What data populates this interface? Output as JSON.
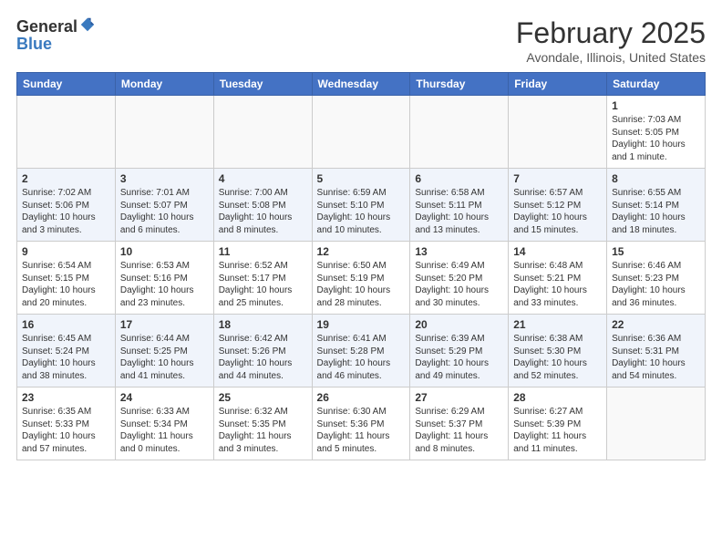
{
  "header": {
    "logo_general": "General",
    "logo_blue": "Blue",
    "month_title": "February 2025",
    "subtitle": "Avondale, Illinois, United States"
  },
  "weekdays": [
    "Sunday",
    "Monday",
    "Tuesday",
    "Wednesday",
    "Thursday",
    "Friday",
    "Saturday"
  ],
  "weeks": [
    [
      {
        "day": "",
        "info": ""
      },
      {
        "day": "",
        "info": ""
      },
      {
        "day": "",
        "info": ""
      },
      {
        "day": "",
        "info": ""
      },
      {
        "day": "",
        "info": ""
      },
      {
        "day": "",
        "info": ""
      },
      {
        "day": "1",
        "info": "Sunrise: 7:03 AM\nSunset: 5:05 PM\nDaylight: 10 hours\nand 1 minute."
      }
    ],
    [
      {
        "day": "2",
        "info": "Sunrise: 7:02 AM\nSunset: 5:06 PM\nDaylight: 10 hours\nand 3 minutes."
      },
      {
        "day": "3",
        "info": "Sunrise: 7:01 AM\nSunset: 5:07 PM\nDaylight: 10 hours\nand 6 minutes."
      },
      {
        "day": "4",
        "info": "Sunrise: 7:00 AM\nSunset: 5:08 PM\nDaylight: 10 hours\nand 8 minutes."
      },
      {
        "day": "5",
        "info": "Sunrise: 6:59 AM\nSunset: 5:10 PM\nDaylight: 10 hours\nand 10 minutes."
      },
      {
        "day": "6",
        "info": "Sunrise: 6:58 AM\nSunset: 5:11 PM\nDaylight: 10 hours\nand 13 minutes."
      },
      {
        "day": "7",
        "info": "Sunrise: 6:57 AM\nSunset: 5:12 PM\nDaylight: 10 hours\nand 15 minutes."
      },
      {
        "day": "8",
        "info": "Sunrise: 6:55 AM\nSunset: 5:14 PM\nDaylight: 10 hours\nand 18 minutes."
      }
    ],
    [
      {
        "day": "9",
        "info": "Sunrise: 6:54 AM\nSunset: 5:15 PM\nDaylight: 10 hours\nand 20 minutes."
      },
      {
        "day": "10",
        "info": "Sunrise: 6:53 AM\nSunset: 5:16 PM\nDaylight: 10 hours\nand 23 minutes."
      },
      {
        "day": "11",
        "info": "Sunrise: 6:52 AM\nSunset: 5:17 PM\nDaylight: 10 hours\nand 25 minutes."
      },
      {
        "day": "12",
        "info": "Sunrise: 6:50 AM\nSunset: 5:19 PM\nDaylight: 10 hours\nand 28 minutes."
      },
      {
        "day": "13",
        "info": "Sunrise: 6:49 AM\nSunset: 5:20 PM\nDaylight: 10 hours\nand 30 minutes."
      },
      {
        "day": "14",
        "info": "Sunrise: 6:48 AM\nSunset: 5:21 PM\nDaylight: 10 hours\nand 33 minutes."
      },
      {
        "day": "15",
        "info": "Sunrise: 6:46 AM\nSunset: 5:23 PM\nDaylight: 10 hours\nand 36 minutes."
      }
    ],
    [
      {
        "day": "16",
        "info": "Sunrise: 6:45 AM\nSunset: 5:24 PM\nDaylight: 10 hours\nand 38 minutes."
      },
      {
        "day": "17",
        "info": "Sunrise: 6:44 AM\nSunset: 5:25 PM\nDaylight: 10 hours\nand 41 minutes."
      },
      {
        "day": "18",
        "info": "Sunrise: 6:42 AM\nSunset: 5:26 PM\nDaylight: 10 hours\nand 44 minutes."
      },
      {
        "day": "19",
        "info": "Sunrise: 6:41 AM\nSunset: 5:28 PM\nDaylight: 10 hours\nand 46 minutes."
      },
      {
        "day": "20",
        "info": "Sunrise: 6:39 AM\nSunset: 5:29 PM\nDaylight: 10 hours\nand 49 minutes."
      },
      {
        "day": "21",
        "info": "Sunrise: 6:38 AM\nSunset: 5:30 PM\nDaylight: 10 hours\nand 52 minutes."
      },
      {
        "day": "22",
        "info": "Sunrise: 6:36 AM\nSunset: 5:31 PM\nDaylight: 10 hours\nand 54 minutes."
      }
    ],
    [
      {
        "day": "23",
        "info": "Sunrise: 6:35 AM\nSunset: 5:33 PM\nDaylight: 10 hours\nand 57 minutes."
      },
      {
        "day": "24",
        "info": "Sunrise: 6:33 AM\nSunset: 5:34 PM\nDaylight: 11 hours\nand 0 minutes."
      },
      {
        "day": "25",
        "info": "Sunrise: 6:32 AM\nSunset: 5:35 PM\nDaylight: 11 hours\nand 3 minutes."
      },
      {
        "day": "26",
        "info": "Sunrise: 6:30 AM\nSunset: 5:36 PM\nDaylight: 11 hours\nand 5 minutes."
      },
      {
        "day": "27",
        "info": "Sunrise: 6:29 AM\nSunset: 5:37 PM\nDaylight: 11 hours\nand 8 minutes."
      },
      {
        "day": "28",
        "info": "Sunrise: 6:27 AM\nSunset: 5:39 PM\nDaylight: 11 hours\nand 11 minutes."
      },
      {
        "day": "",
        "info": ""
      }
    ]
  ]
}
